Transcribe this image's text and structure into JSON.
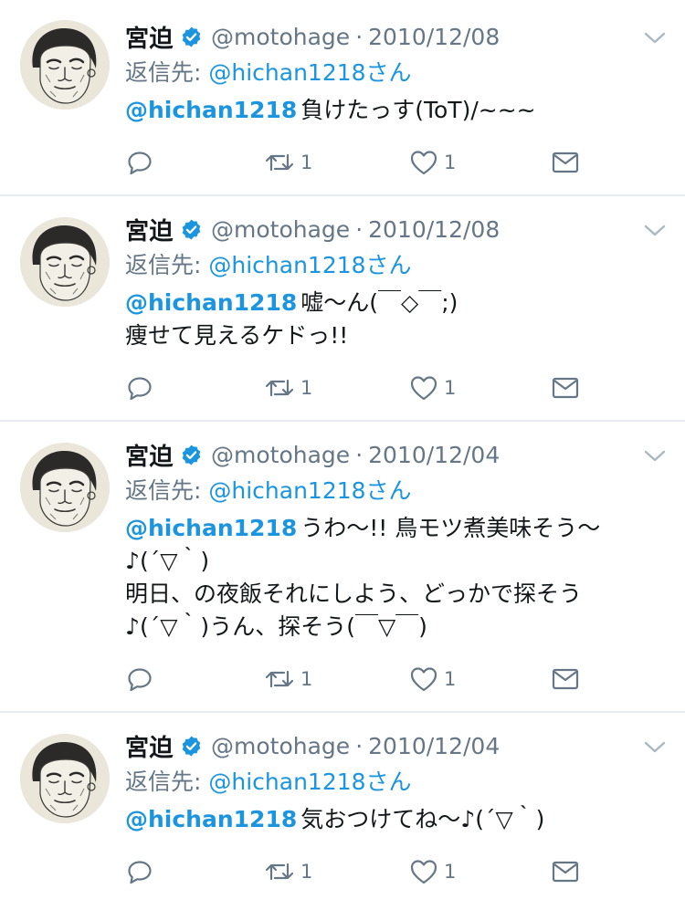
{
  "colors": {
    "link": "#1b95e0",
    "muted": "#657786",
    "text": "#14171a",
    "divider": "#e6ecf0"
  },
  "icons": [
    "verified-badge-icon",
    "chevron-down-icon",
    "reply-icon",
    "retweet-icon",
    "like-icon",
    "dm-icon"
  ],
  "tweets": [
    {
      "author": "宮迫",
      "handle": "@motohage",
      "separator": "·",
      "date": "2010/12/08",
      "reply_prefix": "返信先: ",
      "reply_to": "@hichan1218さん",
      "mention": "@hichan1218",
      "lines": [
        "負けたっす(ToT)/~~~"
      ],
      "retweets": "1",
      "likes": "1"
    },
    {
      "author": "宮迫",
      "handle": "@motohage",
      "separator": "·",
      "date": "2010/12/08",
      "reply_prefix": "返信先: ",
      "reply_to": "@hichan1218さん",
      "mention": "@hichan1218",
      "lines": [
        "嘘〜ん(￣◇￣;)",
        "痩せて見えるケドっ!!"
      ],
      "retweets": "1",
      "likes": "1"
    },
    {
      "author": "宮迫",
      "handle": "@motohage",
      "separator": "·",
      "date": "2010/12/04",
      "reply_prefix": "返信先: ",
      "reply_to": "@hichan1218さん",
      "mention": "@hichan1218",
      "lines": [
        "うわ〜!! 鳥モツ煮美味そう〜",
        "♪(´▽｀)",
        "明日、の夜飯それにしよう、どっかで探そう",
        "♪(´▽｀)うん、探そう(￣▽￣)"
      ],
      "retweets": "1",
      "likes": "1"
    },
    {
      "author": "宮迫",
      "handle": "@motohage",
      "separator": "·",
      "date": "2010/12/04",
      "reply_prefix": "返信先: ",
      "reply_to": "@hichan1218さん",
      "mention": "@hichan1218",
      "lines": [
        "気おつけてね〜♪(´▽｀)"
      ],
      "retweets": "1",
      "likes": "1"
    }
  ]
}
